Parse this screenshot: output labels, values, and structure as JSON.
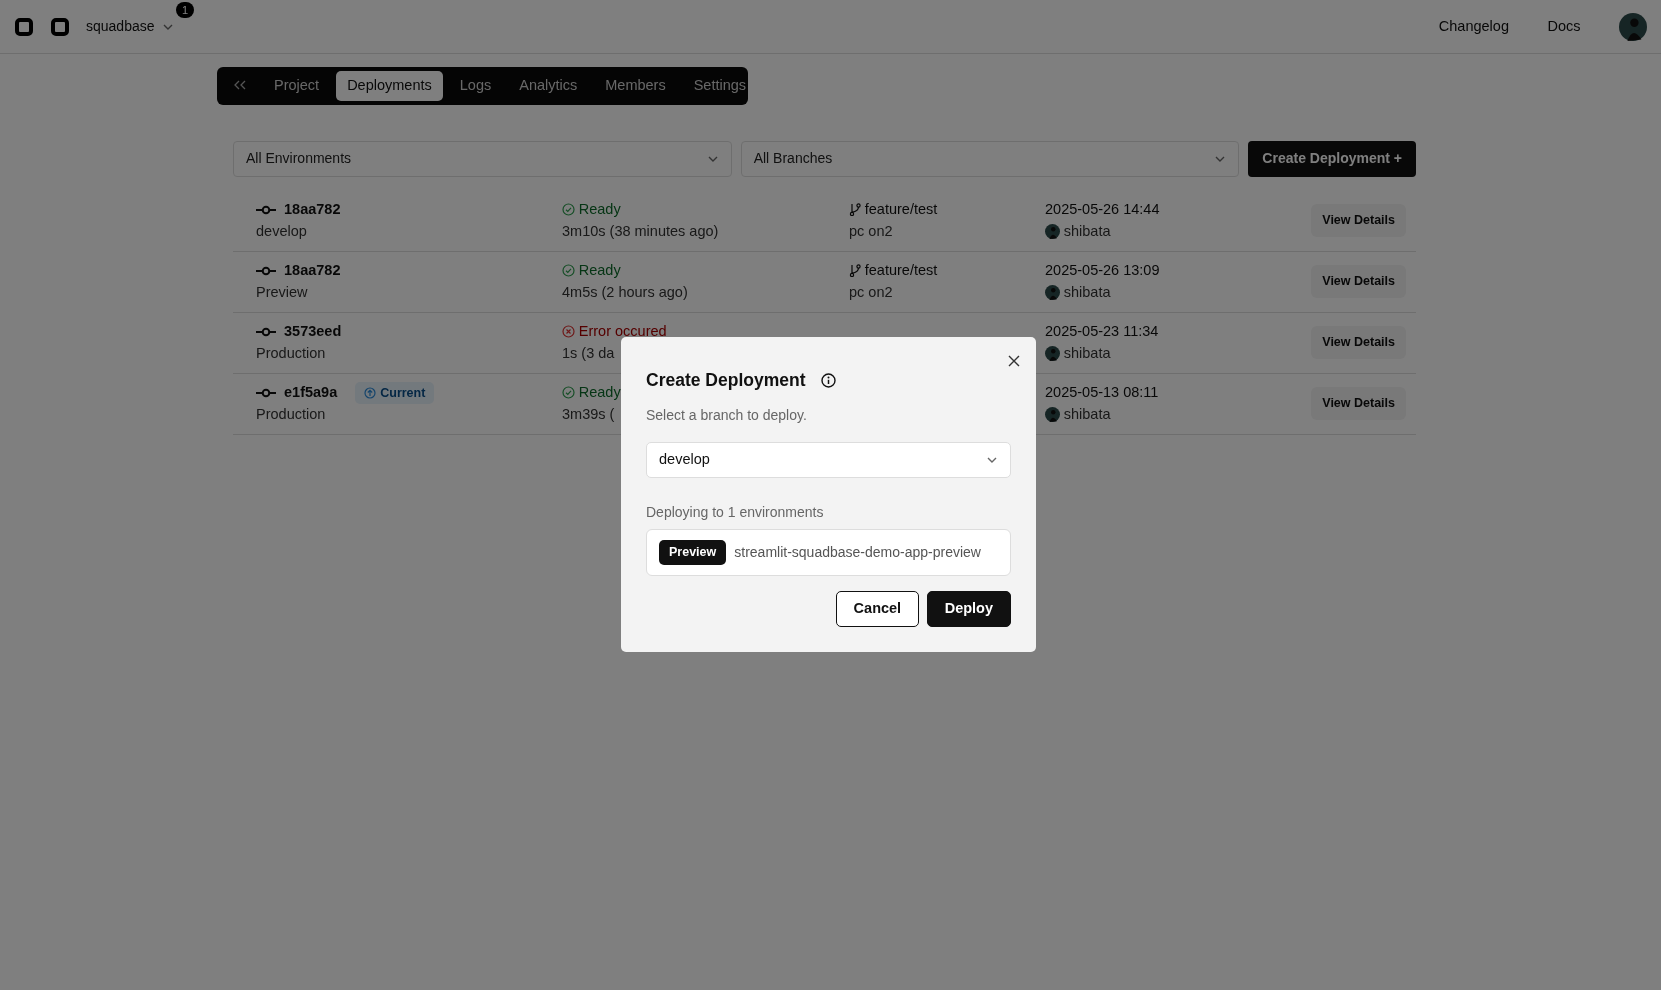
{
  "header": {
    "workspace": "squadbase",
    "notification_count": "1",
    "links": [
      "Changelog",
      "Docs"
    ]
  },
  "tabs": [
    {
      "label": "Project",
      "selected": false
    },
    {
      "label": "Deployments",
      "selected": true
    },
    {
      "label": "Logs",
      "selected": false
    },
    {
      "label": "Analytics",
      "selected": false
    },
    {
      "label": "Members",
      "selected": false
    },
    {
      "label": "Settings",
      "selected": false
    }
  ],
  "filters": {
    "environment": "All Environments",
    "branch": "All Branches",
    "create_button": "Create Deployment +"
  },
  "deployments": [
    {
      "commit": "18aa782",
      "environment": "develop",
      "status": {
        "kind": "ready",
        "label": "Ready"
      },
      "duration": "3m10s (38 minutes ago)",
      "branch": "feature/test",
      "message": "pc on2",
      "date": "2025-05-26 14:44",
      "author": "shibata",
      "action": "View Details"
    },
    {
      "commit": "18aa782",
      "environment": "Preview",
      "status": {
        "kind": "ready",
        "label": "Ready"
      },
      "duration": "4m5s (2 hours ago)",
      "branch": "feature/test",
      "message": "pc on2",
      "date": "2025-05-26 13:09",
      "author": "shibata",
      "action": "View Details"
    },
    {
      "commit": "3573eed",
      "environment": "Production",
      "status": {
        "kind": "error",
        "label": "Error occured"
      },
      "duration": "1s (3 da",
      "date": "2025-05-23 11:34",
      "author": "shibata",
      "action": "View Details"
    },
    {
      "commit": "e1f5a9a",
      "badge": "Current",
      "environment": "Production",
      "status": {
        "kind": "ready",
        "label": "Ready"
      },
      "duration": "3m39s (",
      "date": "2025-05-13 08:11",
      "author": "shibata",
      "action": "View Details"
    }
  ],
  "modal": {
    "title": "Create Deployment",
    "subtitle": "Select a branch to deploy.",
    "branch": "develop",
    "targets_label": "Deploying to 1 environments",
    "targets": [
      {
        "environment": "Preview",
        "app": "streamlit-squadbase-demo-app-preview"
      }
    ],
    "buttons": [
      {
        "kind": "secondary",
        "label": "Cancel"
      },
      {
        "kind": "primary",
        "label": "Deploy"
      }
    ]
  }
}
